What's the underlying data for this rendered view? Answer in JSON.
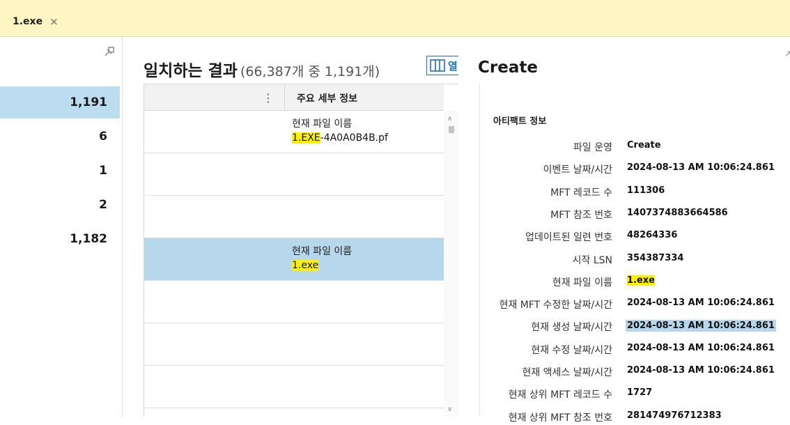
{
  "tab": {
    "title": "1.exe",
    "close_glyph": "×"
  },
  "left_pane": {
    "pin_icon": "pin-icon",
    "counts": [
      "1,191",
      "6",
      "1",
      "2",
      "1,182"
    ],
    "selected_index": 0
  },
  "results": {
    "title": "일치하는 결과",
    "subtitle": "(66,387개 중 1,191개)",
    "columns_button_label": "열",
    "header_menu": "⋮",
    "header_label": "주요 세부 정보",
    "rows": [
      {
        "label": "현재 파일 이름",
        "value_hl": "1.EXE",
        "value_rest": "-4A0A0B4B.pf",
        "selected": false
      },
      {
        "label": "",
        "value_hl": "",
        "value_rest": "",
        "selected": false
      },
      {
        "label": "",
        "value_hl": "",
        "value_rest": "",
        "selected": false
      },
      {
        "label": "현재 파일 이름",
        "value_hl": "1.exe",
        "value_rest": "",
        "selected": true
      },
      {
        "label": "",
        "value_hl": "",
        "value_rest": "",
        "selected": false
      },
      {
        "label": "",
        "value_hl": "",
        "value_rest": "",
        "selected": false
      },
      {
        "label": "",
        "value_hl": "",
        "value_rest": "",
        "selected": false
      }
    ]
  },
  "detail": {
    "title": "Create",
    "section": "아티팩트 정보",
    "properties": [
      {
        "label": "파일 운영",
        "value": "Create",
        "style": ""
      },
      {
        "label": "이벤트 날짜/시간",
        "value": "2024-08-13 AM 10:06:24.861",
        "style": ""
      },
      {
        "label": "MFT 레코드 수",
        "value": "111306",
        "style": ""
      },
      {
        "label": "MFT 참조 번호",
        "value": "1407374883664586",
        "style": ""
      },
      {
        "label": "업데이트된 일련 번호",
        "value": "48264336",
        "style": ""
      },
      {
        "label": "시작 LSN",
        "value": "354387334",
        "style": ""
      },
      {
        "label": "현재 파일 이름",
        "value": "1.exe",
        "style": "hl"
      },
      {
        "label": "현재 MFT 수정한 날짜/시간",
        "value": "2024-08-13 AM 10:06:24.861",
        "style": ""
      },
      {
        "label": "현재 생성 날짜/시간",
        "value": "2024-08-13 AM 10:06:24.861",
        "style": "sel"
      },
      {
        "label": "현재 수정 날짜/시간",
        "value": "2024-08-13 AM 10:06:24.861",
        "style": ""
      },
      {
        "label": "현재 액세스 날짜/시간",
        "value": "2024-08-13 AM 10:06:24.861",
        "style": ""
      },
      {
        "label": "현재 상위 MFT 레코드 수",
        "value": "1727",
        "style": ""
      },
      {
        "label": "현재 상위 MFT 참조 번호",
        "value": "281474976712383",
        "style": ""
      }
    ]
  },
  "colors": {
    "tab_bg": "#fdf6c3",
    "selection": "#b7d7ec",
    "highlight": "#fff200",
    "accent": "#1b6fbd"
  }
}
